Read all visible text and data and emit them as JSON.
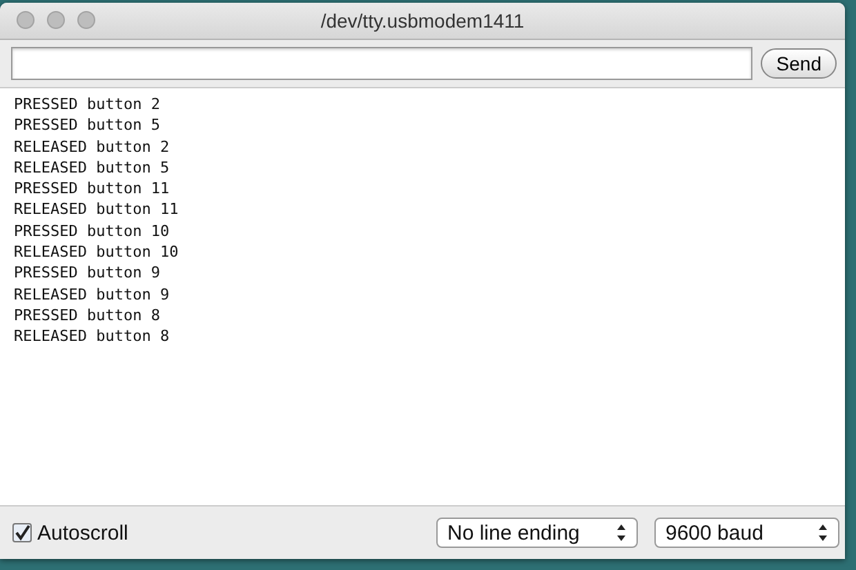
{
  "window": {
    "title": "/dev/tty.usbmodem1411"
  },
  "send_button": "Send",
  "output_lines": [
    "PRESSED button 2",
    "PRESSED button 5",
    "RELEASED button 2",
    "RELEASED button 5",
    "PRESSED button 11",
    "RELEASED button 11",
    "PRESSED button 10",
    "RELEASED button 10",
    "PRESSED button 9",
    "RELEASED button 9",
    "PRESSED button 8",
    "RELEASED button 8"
  ],
  "autoscroll": {
    "label": "Autoscroll",
    "checked": true
  },
  "line_ending": {
    "value": "No line ending"
  },
  "baud_rate": {
    "value": "9600 baud"
  }
}
